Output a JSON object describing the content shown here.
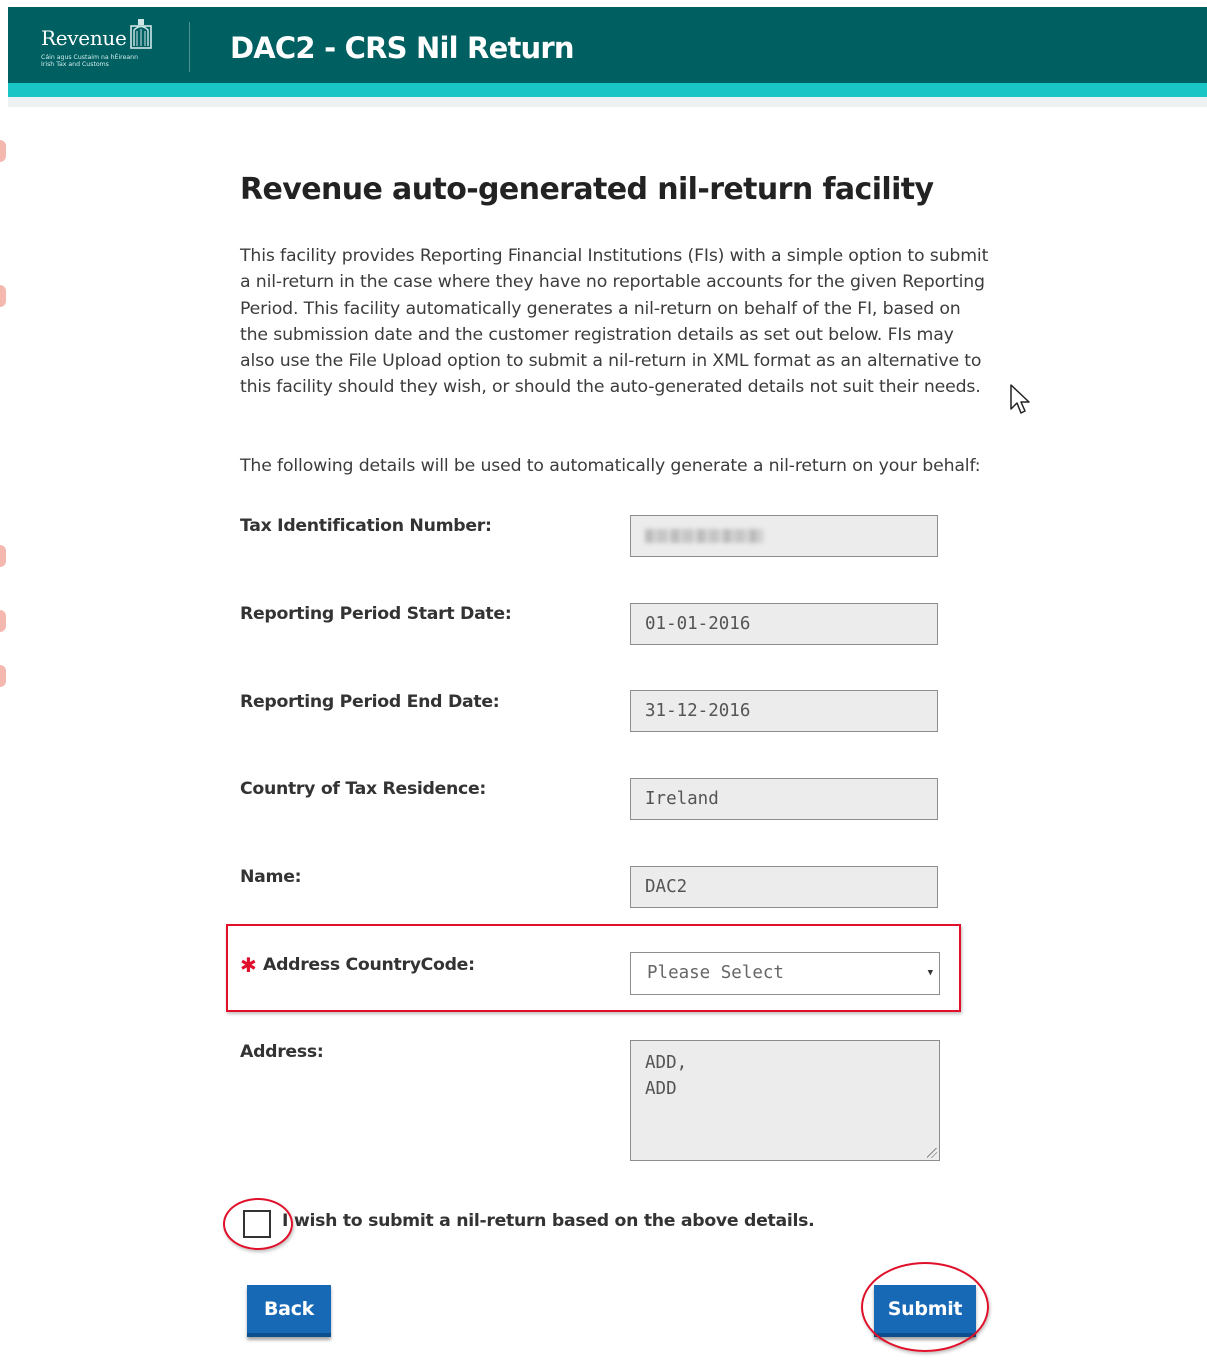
{
  "header": {
    "logo_word": "Revenue",
    "logo_sub_line1": "Cáin agus Custaim na hÉireann",
    "logo_sub_line2": "Irish Tax and Customs",
    "title": "DAC2 - CRS Nil Return",
    "brand_color": "#005f61",
    "accent_color": "#19c5c5"
  },
  "content": {
    "title": "Revenue auto-generated nil-return facility",
    "intro": "This facility provides Reporting Financial Institutions (FIs) with a simple option to submit a nil-return in the case where they have no reportable accounts for the given Reporting Period. This facility automatically generates a nil-return on behalf of the FI, based on the submission date and the customer registration details as set out below. FIs may also use the File Upload option to submit a nil-return in XML format as an alternative to this facility should they wish, or should the auto-generated details not suit their needs.",
    "details_intro": "The following details will be used to automatically generate a nil-return on your behalf:"
  },
  "form": {
    "tin_label": "Tax Identification Number:",
    "tin_value": "",
    "start_label": "Reporting Period Start Date:",
    "start_value": "01-01-2016",
    "end_label": "Reporting Period End Date:",
    "end_value": "31-12-2016",
    "country_label": "Country of Tax Residence:",
    "country_value": "Ireland",
    "name_label": "Name:",
    "name_value": "DAC2",
    "required_marker": "✱",
    "address_country_label": "Address CountryCode:",
    "address_country_selected": "Please Select",
    "address_label": "Address:",
    "address_line1": "ADD,",
    "address_line2": "ADD",
    "confirm_label": "I wish to submit a nil-return based on the above details.",
    "confirm_checked": false
  },
  "buttons": {
    "back": "Back",
    "submit": "Submit",
    "button_color": "#1769b6"
  },
  "annotation_color": "#e0102a"
}
